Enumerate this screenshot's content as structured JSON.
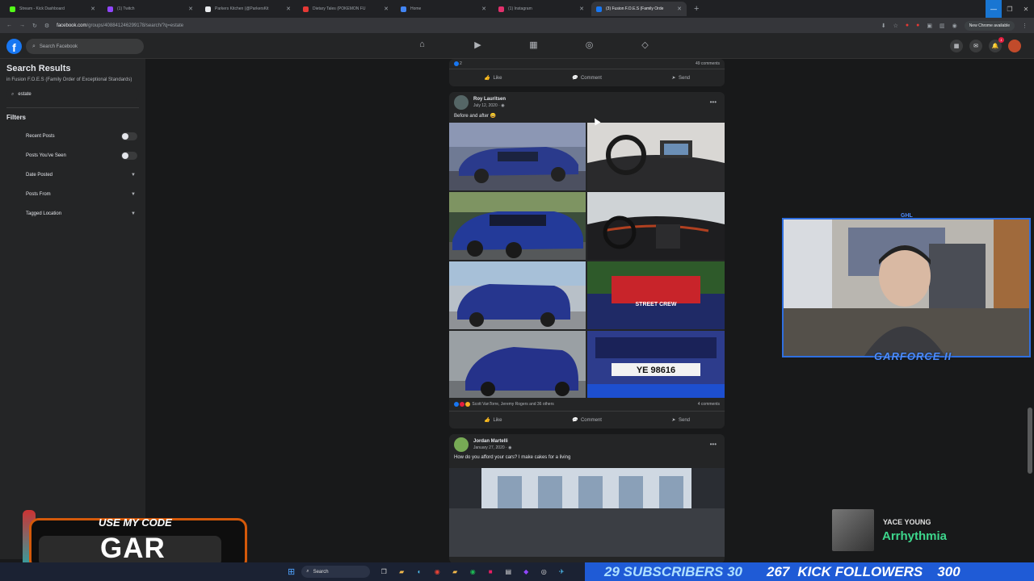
{
  "browser": {
    "tabs": [
      {
        "label": "Stream - Kick Dashboard",
        "color": "#53fc18",
        "active": false
      },
      {
        "label": "(1) Twitch",
        "color": "#9146ff",
        "active": false
      },
      {
        "label": "Parkers Kitchen (@ParkersKit",
        "color": "#e8eaed",
        "active": false
      },
      {
        "label": "Dietary Tales (POKEMON FU",
        "color": "#e53935",
        "active": false
      },
      {
        "label": "Home",
        "color": "#4285f4",
        "active": false
      },
      {
        "label": "(1) Instagram",
        "color": "#e1306c",
        "active": false
      },
      {
        "label": "(3) Fusion F.O.E.S (Family Orde",
        "color": "#1877f2",
        "active": true
      }
    ],
    "url_host": "facebook.com",
    "url_path": "/groups/408841246299178/search/?q=estate",
    "new_chrome_label": "New Chrome available"
  },
  "facebook": {
    "logo": "f",
    "search_placeholder": "Search Facebook",
    "nav_icons": [
      "home-icon",
      "video-icon",
      "marketplace-icon",
      "groups-icon",
      "gaming-icon"
    ],
    "notification_count": "1"
  },
  "sidebar": {
    "title": "Search Results",
    "subtitle": "in Fusion F.O.E.S (Family Order of Exceptional Standards)",
    "query": "estate",
    "filters_heading": "Filters",
    "filters": [
      {
        "label": "Recent Posts",
        "type": "toggle"
      },
      {
        "label": "Posts You've Seen",
        "type": "toggle"
      },
      {
        "label": "Date Posted",
        "type": "dropdown"
      },
      {
        "label": "Posts From",
        "type": "dropdown"
      },
      {
        "label": "Tagged Location",
        "type": "dropdown"
      }
    ]
  },
  "feed": {
    "prev_post": {
      "reactions": "2",
      "comments": "49 comments"
    },
    "actions": {
      "like": "Like",
      "comment": "Comment",
      "send": "Send"
    },
    "post1": {
      "author": "Roy Lauritsen",
      "date": "July 12, 2020 · ",
      "text": "Before and after 😀",
      "reactions": "Scott VanTorre, Jeremy Rogers and 36 others",
      "comments": "4 comments",
      "plate": "YE 98616",
      "plate2": "STREET CREW"
    },
    "post2": {
      "author": "Jordan Martelli",
      "date": "January 27, 2020 · ",
      "text": "How do you afford your cars? I make cakes for a living"
    }
  },
  "overlay": {
    "webcam_tag": "GARFORCE II",
    "webcam_tag2": "GHL",
    "promo_top": "USE MY CODE",
    "promo_code": "GAR",
    "music_artist": "YACE YOUNG",
    "music_song": "Arrhythmia",
    "stats": [
      "29 SUBSCRIBERS 30",
      "267",
      "KICK FOLLOWERS",
      "300"
    ]
  },
  "taskbar": {
    "search_label": "Search"
  },
  "colors": {
    "fb_blue": "#1877f2",
    "bg": "#18191a",
    "card": "#242526",
    "accent_overlay": "#1f5bd6",
    "promo_orange": "#d4590a",
    "song_green": "#3dd68c"
  }
}
